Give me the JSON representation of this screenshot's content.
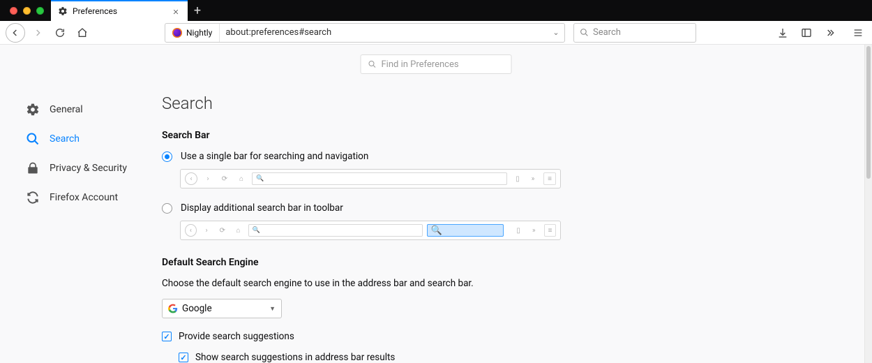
{
  "window": {
    "tab_title": "Preferences"
  },
  "toolbar": {
    "identity_label": "Nightly",
    "url": "about:preferences#search",
    "search_placeholder": "Search"
  },
  "find": {
    "placeholder": "Find in Preferences"
  },
  "sidebar": {
    "items": [
      {
        "id": "general",
        "label": "General"
      },
      {
        "id": "search",
        "label": "Search"
      },
      {
        "id": "privacy",
        "label": "Privacy & Security"
      },
      {
        "id": "account",
        "label": "Firefox Account"
      }
    ],
    "active": "search"
  },
  "page": {
    "title": "Search",
    "search_bar": {
      "heading": "Search Bar",
      "opt_single": "Use a single bar for searching and navigation",
      "opt_separate": "Display additional search bar in toolbar",
      "selected": "single"
    },
    "default_engine": {
      "heading": "Default Search Engine",
      "desc": "Choose the default search engine to use in the address bar and search bar.",
      "selected": "Google",
      "provide_suggestions_label": "Provide search suggestions",
      "provide_suggestions": true,
      "show_in_addrbar_label": "Show search suggestions in address bar results",
      "show_in_addrbar": true
    }
  }
}
